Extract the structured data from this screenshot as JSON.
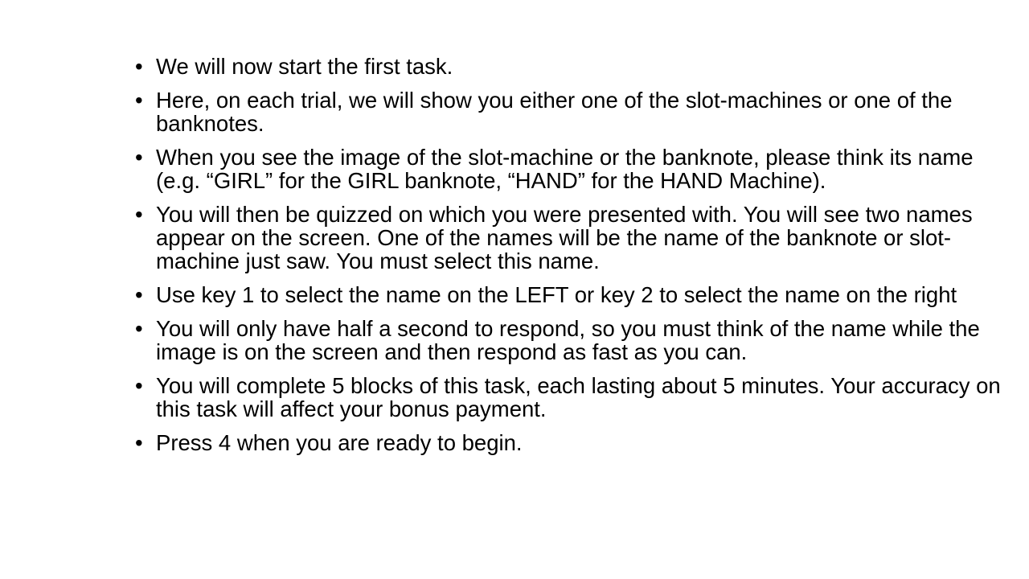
{
  "bullet_glyph": "•",
  "items": [
    "We will now start the first task.",
    "Here, on each trial, we will show you either one of the slot-machines or one of the banknotes.",
    "When you see the image of the slot-machine or the banknote, please think its name (e.g. “GIRL” for the GIRL banknote, “HAND” for the HAND Machine).",
    "You will then be quizzed on which you were presented with. You will see two names appear on the screen. One of the names will be the name of the banknote or slot-machine just saw. You must select this name.",
    "Use key 1 to select the name on the LEFT or key 2 to select the name on the right",
    "You will only have half a second to respond, so you must think of the name while the image is on the screen and then respond as fast as you can.",
    "You will complete 5 blocks of this task, each lasting about 5 minutes. Your accuracy on this task will affect your bonus payment.",
    "Press 4 when you are ready to begin."
  ]
}
